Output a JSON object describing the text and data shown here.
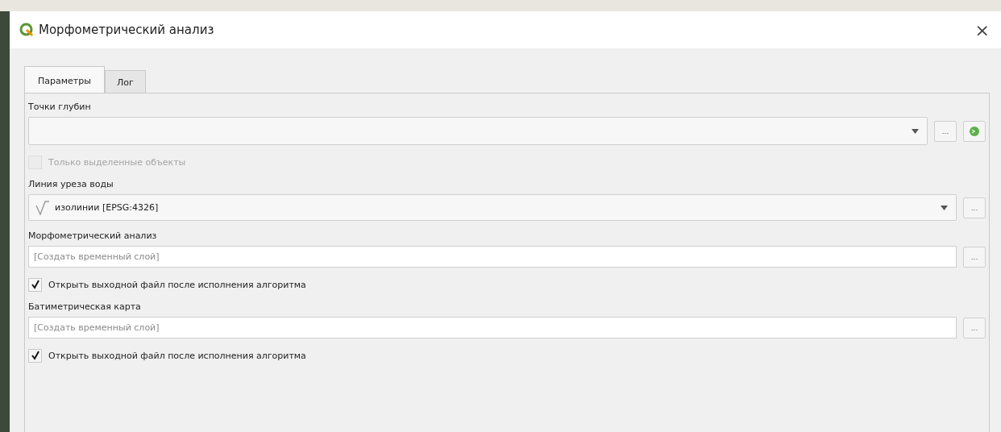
{
  "window": {
    "title": "Морфометрический анализ",
    "close": "×"
  },
  "tabs": [
    {
      "label": "Параметры",
      "selected": true
    },
    {
      "label": "Лог",
      "selected": false
    }
  ],
  "parameters": [
    {
      "kind": "label",
      "text": "Точки глубин"
    },
    {
      "kind": "layer_select",
      "browse": "...",
      "iterate_button": true
    },
    {
      "kind": "checkbox",
      "label": "Только выделенные объекты",
      "checked": false,
      "disabled": true
    },
    {
      "kind": "label",
      "text": "Линия уреза воды"
    },
    {
      "kind": "layer_select",
      "value": "изолинии [EPSG:4326]",
      "line_layer_icon": true,
      "browse": "..."
    },
    {
      "kind": "label",
      "text": "Морфометрический анализ"
    },
    {
      "kind": "output",
      "placeholder": "[Создать временный слой]",
      "browse": "..."
    },
    {
      "kind": "checkbox",
      "label": "Открыть выходной файл после исполнения алгоритма",
      "checked": true,
      "disabled": false
    },
    {
      "kind": "label",
      "text": "Батиметрическая карта"
    },
    {
      "kind": "output",
      "placeholder": "[Создать временный слой]",
      "browse": "..."
    },
    {
      "kind": "checkbox",
      "label": "Открыть выходной файл после исполнения алгоритма",
      "checked": true,
      "disabled": false
    }
  ]
}
